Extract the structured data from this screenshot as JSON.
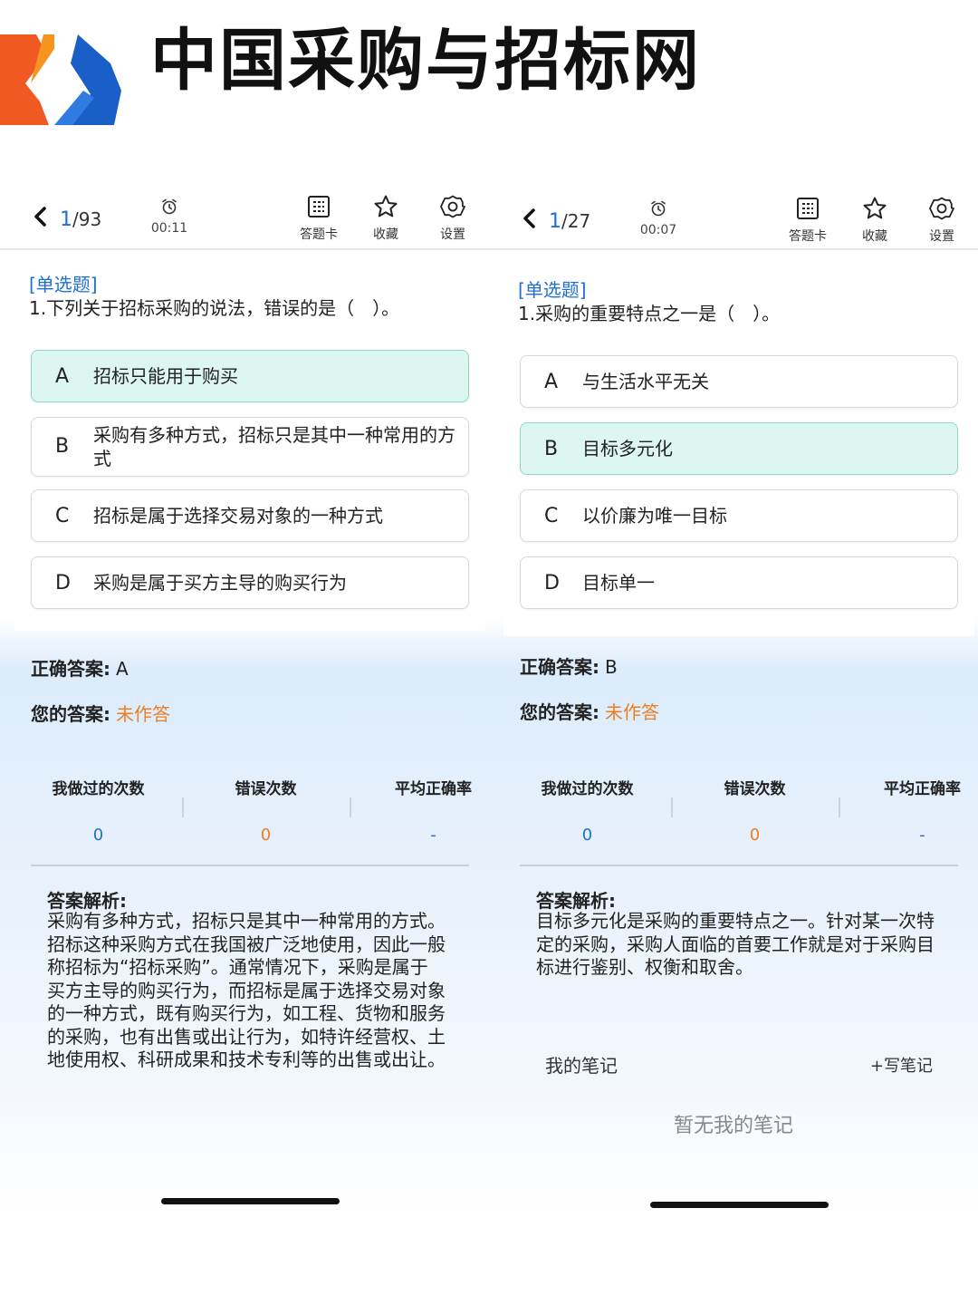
{
  "banner": {
    "site_title": "中国采购与招标网",
    "logo_colors": [
      "#f05a22",
      "#1a5fc8"
    ]
  },
  "labels": {
    "answer_card": "答题卡",
    "favorite": "收藏",
    "settings": "设置",
    "correct_answer": "正确答案:",
    "your_answer": "您的答案:",
    "times_done": "我做过的次数",
    "error_count": "错误次数",
    "avg_accuracy": "平均正确率",
    "analysis": "答案解析:",
    "my_notes": "我的笔记",
    "write_note": "+写笔记",
    "no_notes": "暂无我的笔记"
  },
  "colors": {
    "accent": "#1f6fd1",
    "orange": "#ef7d22",
    "selected_bg": "#def6f0"
  },
  "panels": [
    {
      "counter_current": "1",
      "counter_total": "/93",
      "timer": "00:11",
      "question_type": "[单选题]",
      "question": "1.下列关于招标采购的说法，错误的是（　）。",
      "options": [
        {
          "letter": "A",
          "text": "招标只能用于购买",
          "selected": true
        },
        {
          "letter": "B",
          "text": "采购有多种方式，招标只是其中一种常用的方式",
          "selected": false
        },
        {
          "letter": "C",
          "text": "招标是属于选择交易对象的一种方式",
          "selected": false
        },
        {
          "letter": "D",
          "text": "采购是属于买方主导的购买行为",
          "selected": false
        }
      ],
      "correct_answer": "A",
      "your_answer": "未作答",
      "stats": {
        "times_done": "0",
        "error_count": "0",
        "avg_accuracy": "-"
      },
      "analysis": "采购有多种方式，招标只是其中一种常用的方式。招标这种采购方式在我国被广泛地使用，因此一般称招标为“招标采购”。通常情况下，采购是属于买方主导的购买行为，而招标是属于选择交易对象的一种方式，既有购买行为，如工程、货物和服务的采购，也有出售或出让行为，如特许经营权、土地使用权、科研成果和技术专利等的出售或出让。"
    },
    {
      "counter_current": "1",
      "counter_total": "/27",
      "timer": "00:07",
      "question_type": "[单选题]",
      "question": "1.采购的重要特点之一是（　）。",
      "options": [
        {
          "letter": "A",
          "text": "与生活水平无关",
          "selected": false
        },
        {
          "letter": "B",
          "text": "目标多元化",
          "selected": true
        },
        {
          "letter": "C",
          "text": "以价廉为唯一目标",
          "selected": false
        },
        {
          "letter": "D",
          "text": "目标单一",
          "selected": false
        }
      ],
      "correct_answer": "B",
      "your_answer": "未作答",
      "stats": {
        "times_done": "0",
        "error_count": "0",
        "avg_accuracy": "-"
      },
      "analysis": "目标多元化是采购的重要特点之一。针对某一次特定的采购，采购人面临的首要工作就是对于采购目标进行鉴别、权衡和取舍。"
    }
  ]
}
